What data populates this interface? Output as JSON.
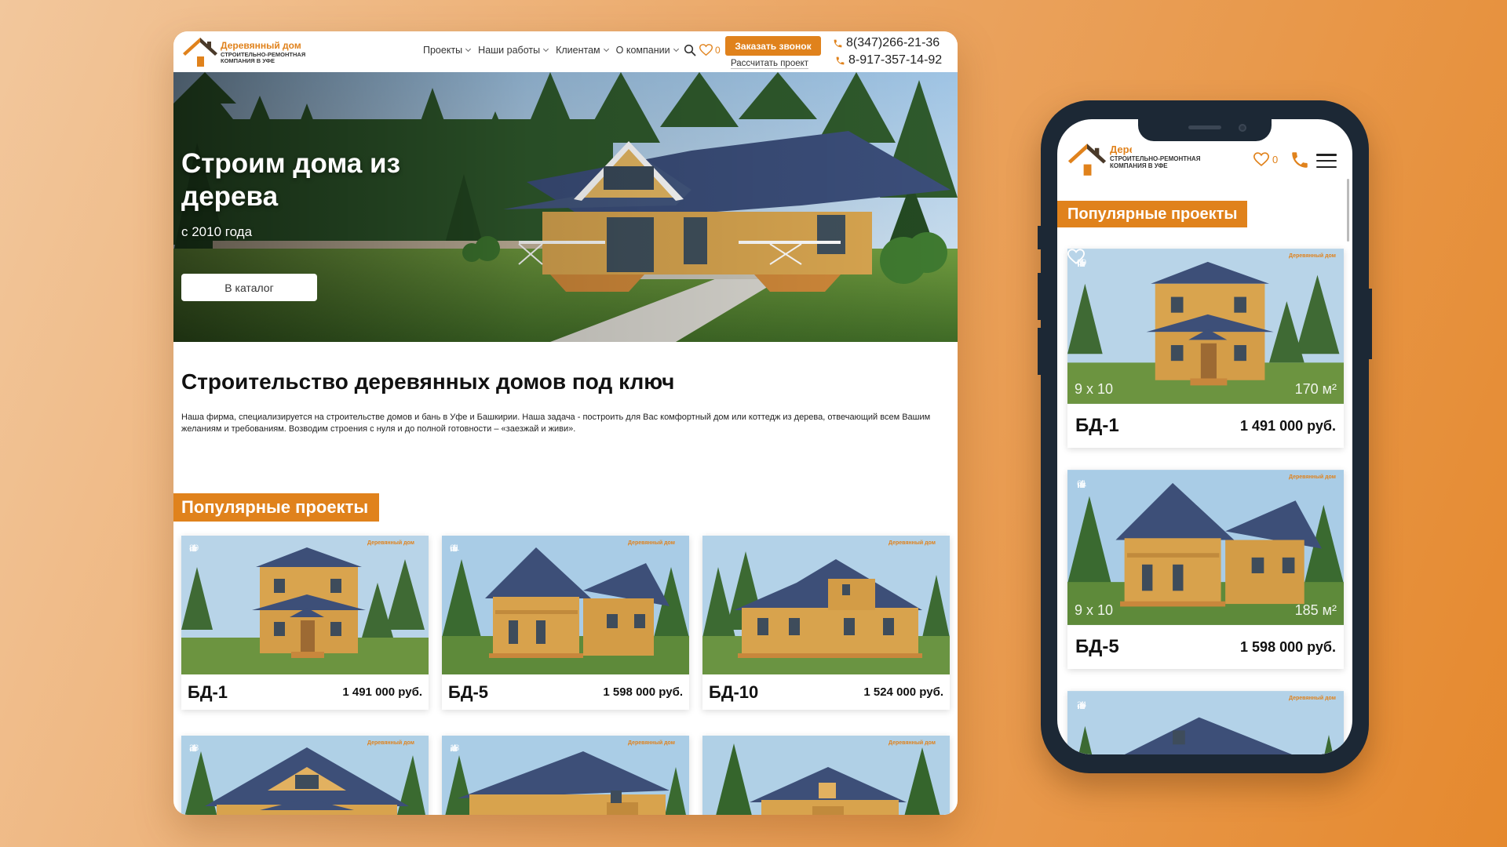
{
  "colors": {
    "accent": "#e0821c",
    "bg_start": "#f2c79c",
    "bg_end": "#e5892e",
    "text": "#111111"
  },
  "logo": {
    "brand": "Деревянный дом",
    "tagline": "Строительно-ремонтная компания в Уфе",
    "icon": "house-logo-icon"
  },
  "desktop": {
    "nav": [
      {
        "label": "Проекты"
      },
      {
        "label": "Наши работы"
      },
      {
        "label": "Клиентам"
      },
      {
        "label": "О компании"
      }
    ],
    "favorites_count": "0",
    "call_button": "Заказать звонок",
    "calc_link": "Рассчитать проект",
    "phones": [
      "8(347)266-21-36",
      "8-917-357-14-92"
    ],
    "hero": {
      "title": "Строим дома из дерева",
      "subtitle": "с 2010 года",
      "button": "В каталог"
    },
    "heading": "Строительство деревянных домов под ключ",
    "paragraph": "Наша фирма, специализируется на строительстве домов и бань в Уфе и Башкирии. Наша задача - построить для Вас комфортный дом или коттедж из дерева, отвечающий всем Вашим желаниям и требованиям. Возводим строения с нуля и до полной готовности – «заезжай и живи».",
    "section_title": "Популярные проекты",
    "watermark": "Деревянный дом",
    "cards": [
      {
        "name": "БД-1",
        "price": "1 491 000 руб.",
        "likes": "89"
      },
      {
        "name": "БД-5",
        "price": "1 598 000 руб.",
        "likes": "61"
      },
      {
        "name": "БД-10",
        "price": "1 524 000 руб.",
        "likes": ""
      },
      {
        "name": "",
        "price": "",
        "likes": "38"
      },
      {
        "name": "",
        "price": "",
        "likes": "18"
      },
      {
        "name": "",
        "price": "",
        "likes": ""
      }
    ]
  },
  "mobile": {
    "favorites_count": "0",
    "section_title": "Популярные проекты",
    "cards": [
      {
        "name": "БД-1",
        "price": "1 491 000 руб.",
        "likes": "89",
        "size": "9 x 10",
        "area": "170 м²"
      },
      {
        "name": "БД-5",
        "price": "1 598 000 руб.",
        "likes": "61",
        "size": "9 x 10",
        "area": "185 м²"
      },
      {
        "name": "",
        "price": "",
        "likes": "34",
        "size": "",
        "area": ""
      }
    ]
  }
}
